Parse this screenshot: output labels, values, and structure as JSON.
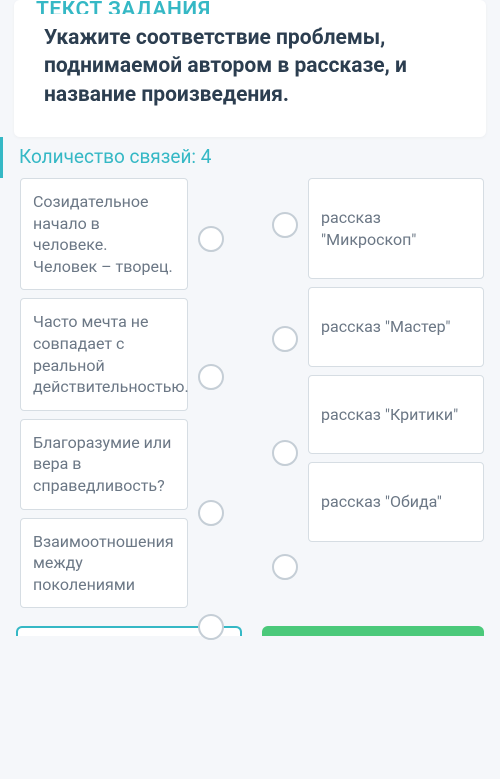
{
  "header_fragment": "ТЕКСТ ЗАДАНИЯ",
  "question": "Укажите соответствие проблемы, поднимаемой автором в рассказе, и название произведения.",
  "connections_label": "Количество связей: 4",
  "left_items": [
    "Созидательное начало в человеке. Человек – творец.",
    "Часто мечта не совпадает с реальной действительностью.",
    "Благоразумие или вера в справедливость?",
    "Взаимоотношения между поколениями"
  ],
  "right_items": [
    "рассказ \"Микроскоп\"",
    "рассказ \"Мастер\"",
    "рассказ \"Критики\"",
    "рассказ \"Обида\""
  ]
}
